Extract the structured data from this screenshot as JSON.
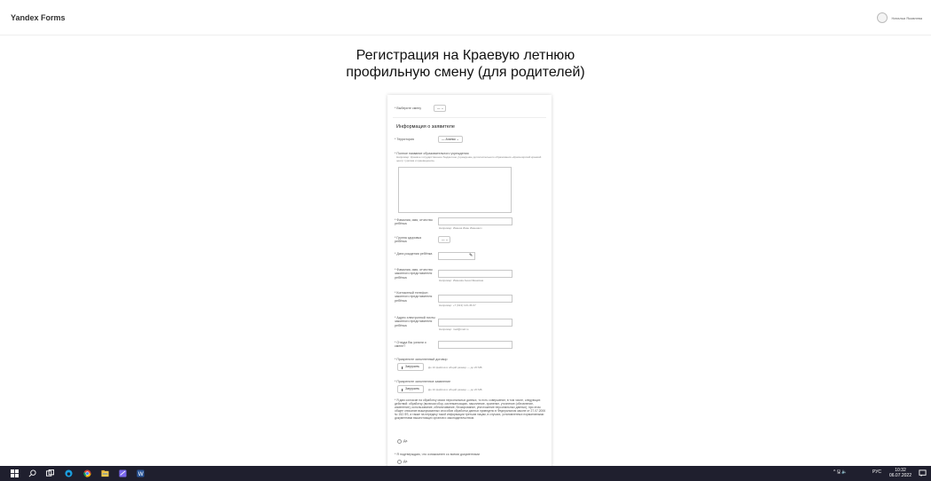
{
  "header": {
    "brand": "Yandex Forms",
    "user_name": "Наталья Яковлева"
  },
  "form": {
    "title_line1": "Регистрация на Краевую летнюю",
    "title_line2": "профильную смену (для родителей)",
    "shift_label": "* Выберите смену",
    "shift_value": "— ⌄",
    "section_title": "Информация о заявителе",
    "territory_label": "* Территория",
    "territory_value": "— Ачинск ⌄",
    "school_label": "* Полное название образовательного учреждения",
    "school_hint": "Например: Краевое государственное бюджетное учреждение дополнительного образования «Красноярский краевой центр туризма и краеведения»",
    "child_name_label": "* Фамилия, имя, отчество ребёнка",
    "child_name_hint": "Например: Иванов Иван Иванович",
    "health_label": "* Группа здоровья ребёнка",
    "health_value": "— ⌄",
    "birth_label": "* Дата рождения ребёнка",
    "parent_name_label": "* Фамилия, имя, отчество законного представителя ребёнка",
    "parent_name_hint": "Например: Иванова Анна Ивановна",
    "phone_label": "* Контактный телефон законного представителя ребёнка",
    "phone_hint": "Например: +7 (913) 123-45-67",
    "email_label": "* Адрес электронной почты законного представителя ребёнка",
    "email_hint": "Например: mail@mail.ru",
    "source_label": "* Откуда Вы узнали о смене?",
    "contract_label": "* Прикрепите заполненный договор",
    "upload_label": "Загрузить",
    "upload_hint": "До 10 файлов в общий размер — до 20 МБ",
    "statement_label": "* Прикрепите заполненное заявление",
    "consent_text": "* Я даю согласие на обработку своих персональных данных, то есть совершение, в том числе, следующих действий: обработку (включая сбор, систематизацию, накопление, хранение, уточнение (обновление, изменение), использование, обезличивание, блокирование, уничтожение персональных данных), при этом общее описание вышеуказанных способов обработки данных приведено в Федеральном законе от 27.07.2006 № 152-ФЗ, а также на передачу такой информации третьим лицам, в случаях, установленных нормативными документами вышестоящих органов и законодательством.",
    "yes_label": "Да",
    "confirm_label": "* Я подтверждаю, что ознакомлен со всеми документами",
    "yes2_label": "Да"
  },
  "taskbar": {
    "lang": "РУС",
    "time": "10:32",
    "date": "06.07.2022",
    "tray": "^ 🖫 🔈"
  }
}
